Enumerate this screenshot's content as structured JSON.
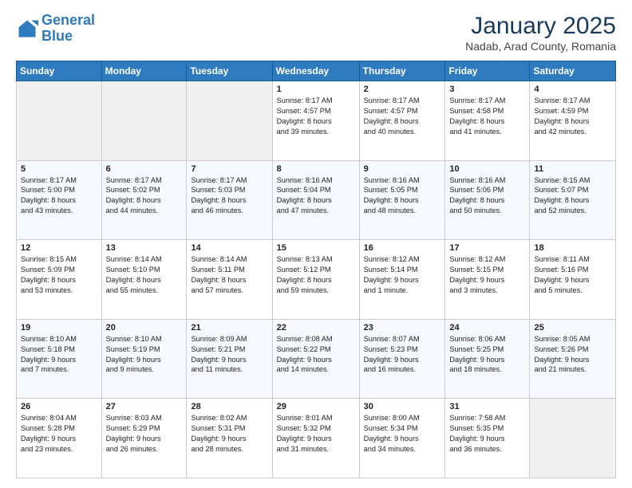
{
  "header": {
    "logo_line1": "General",
    "logo_line2": "Blue",
    "title": "January 2025",
    "subtitle": "Nadab, Arad County, Romania"
  },
  "days_of_week": [
    "Sunday",
    "Monday",
    "Tuesday",
    "Wednesday",
    "Thursday",
    "Friday",
    "Saturday"
  ],
  "weeks": [
    [
      {
        "day": "",
        "info": ""
      },
      {
        "day": "",
        "info": ""
      },
      {
        "day": "",
        "info": ""
      },
      {
        "day": "1",
        "info": "Sunrise: 8:17 AM\nSunset: 4:57 PM\nDaylight: 8 hours\nand 39 minutes."
      },
      {
        "day": "2",
        "info": "Sunrise: 8:17 AM\nSunset: 4:57 PM\nDaylight: 8 hours\nand 40 minutes."
      },
      {
        "day": "3",
        "info": "Sunrise: 8:17 AM\nSunset: 4:58 PM\nDaylight: 8 hours\nand 41 minutes."
      },
      {
        "day": "4",
        "info": "Sunrise: 8:17 AM\nSunset: 4:59 PM\nDaylight: 8 hours\nand 42 minutes."
      }
    ],
    [
      {
        "day": "5",
        "info": "Sunrise: 8:17 AM\nSunset: 5:00 PM\nDaylight: 8 hours\nand 43 minutes."
      },
      {
        "day": "6",
        "info": "Sunrise: 8:17 AM\nSunset: 5:02 PM\nDaylight: 8 hours\nand 44 minutes."
      },
      {
        "day": "7",
        "info": "Sunrise: 8:17 AM\nSunset: 5:03 PM\nDaylight: 8 hours\nand 46 minutes."
      },
      {
        "day": "8",
        "info": "Sunrise: 8:16 AM\nSunset: 5:04 PM\nDaylight: 8 hours\nand 47 minutes."
      },
      {
        "day": "9",
        "info": "Sunrise: 8:16 AM\nSunset: 5:05 PM\nDaylight: 8 hours\nand 48 minutes."
      },
      {
        "day": "10",
        "info": "Sunrise: 8:16 AM\nSunset: 5:06 PM\nDaylight: 8 hours\nand 50 minutes."
      },
      {
        "day": "11",
        "info": "Sunrise: 8:15 AM\nSunset: 5:07 PM\nDaylight: 8 hours\nand 52 minutes."
      }
    ],
    [
      {
        "day": "12",
        "info": "Sunrise: 8:15 AM\nSunset: 5:09 PM\nDaylight: 8 hours\nand 53 minutes."
      },
      {
        "day": "13",
        "info": "Sunrise: 8:14 AM\nSunset: 5:10 PM\nDaylight: 8 hours\nand 55 minutes."
      },
      {
        "day": "14",
        "info": "Sunrise: 8:14 AM\nSunset: 5:11 PM\nDaylight: 8 hours\nand 57 minutes."
      },
      {
        "day": "15",
        "info": "Sunrise: 8:13 AM\nSunset: 5:12 PM\nDaylight: 8 hours\nand 59 minutes."
      },
      {
        "day": "16",
        "info": "Sunrise: 8:12 AM\nSunset: 5:14 PM\nDaylight: 9 hours\nand 1 minute."
      },
      {
        "day": "17",
        "info": "Sunrise: 8:12 AM\nSunset: 5:15 PM\nDaylight: 9 hours\nand 3 minutes."
      },
      {
        "day": "18",
        "info": "Sunrise: 8:11 AM\nSunset: 5:16 PM\nDaylight: 9 hours\nand 5 minutes."
      }
    ],
    [
      {
        "day": "19",
        "info": "Sunrise: 8:10 AM\nSunset: 5:18 PM\nDaylight: 9 hours\nand 7 minutes."
      },
      {
        "day": "20",
        "info": "Sunrise: 8:10 AM\nSunset: 5:19 PM\nDaylight: 9 hours\nand 9 minutes."
      },
      {
        "day": "21",
        "info": "Sunrise: 8:09 AM\nSunset: 5:21 PM\nDaylight: 9 hours\nand 11 minutes."
      },
      {
        "day": "22",
        "info": "Sunrise: 8:08 AM\nSunset: 5:22 PM\nDaylight: 9 hours\nand 14 minutes."
      },
      {
        "day": "23",
        "info": "Sunrise: 8:07 AM\nSunset: 5:23 PM\nDaylight: 9 hours\nand 16 minutes."
      },
      {
        "day": "24",
        "info": "Sunrise: 8:06 AM\nSunset: 5:25 PM\nDaylight: 9 hours\nand 18 minutes."
      },
      {
        "day": "25",
        "info": "Sunrise: 8:05 AM\nSunset: 5:26 PM\nDaylight: 9 hours\nand 21 minutes."
      }
    ],
    [
      {
        "day": "26",
        "info": "Sunrise: 8:04 AM\nSunset: 5:28 PM\nDaylight: 9 hours\nand 23 minutes."
      },
      {
        "day": "27",
        "info": "Sunrise: 8:03 AM\nSunset: 5:29 PM\nDaylight: 9 hours\nand 26 minutes."
      },
      {
        "day": "28",
        "info": "Sunrise: 8:02 AM\nSunset: 5:31 PM\nDaylight: 9 hours\nand 28 minutes."
      },
      {
        "day": "29",
        "info": "Sunrise: 8:01 AM\nSunset: 5:32 PM\nDaylight: 9 hours\nand 31 minutes."
      },
      {
        "day": "30",
        "info": "Sunrise: 8:00 AM\nSunset: 5:34 PM\nDaylight: 9 hours\nand 34 minutes."
      },
      {
        "day": "31",
        "info": "Sunrise: 7:58 AM\nSunset: 5:35 PM\nDaylight: 9 hours\nand 36 minutes."
      },
      {
        "day": "",
        "info": ""
      }
    ]
  ]
}
